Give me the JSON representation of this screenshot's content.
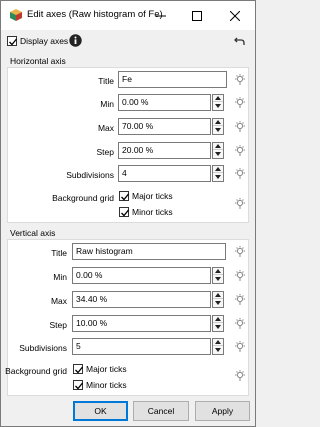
{
  "window": {
    "title": "Edit axes (Raw histogram of Fe)",
    "minimize_glyph": "—",
    "maximize_glyph": "☐",
    "close_glyph": "✕"
  },
  "toolbar": {
    "display_axes_label": "Display axes",
    "display_axes_checked": true
  },
  "horizontal": {
    "group_title": "Horizontal axis",
    "title_label": "Title",
    "title_value": "Fe",
    "min_label": "Min",
    "min_value": "0.00 %",
    "max_label": "Max",
    "max_value": "70.00 %",
    "step_label": "Step",
    "step_value": "20.00 %",
    "subdivisions_label": "Subdivisions",
    "subdivisions_value": "4",
    "grid_label": "Background grid",
    "major_label": "Major ticks",
    "minor_label": "Minor ticks"
  },
  "vertical": {
    "group_title": "Vertical axis",
    "title_label": "Title",
    "title_value": "Raw histogram",
    "min_label": "Min",
    "min_value": "0.00 %",
    "max_label": "Max",
    "max_value": "34.40 %",
    "step_label": "Step",
    "step_value": "10.00 %",
    "subdivisions_label": "Subdivisions",
    "subdivisions_value": "5",
    "grid_label": "Background grid",
    "major_label": "Major ticks",
    "minor_label": "Minor ticks"
  },
  "buttons": {
    "ok": "OK",
    "cancel": "Cancel",
    "apply": "Apply"
  },
  "colors": {
    "accent": "#0078d7",
    "info_icon": "#222222",
    "bulb": "#8a8a8a"
  }
}
